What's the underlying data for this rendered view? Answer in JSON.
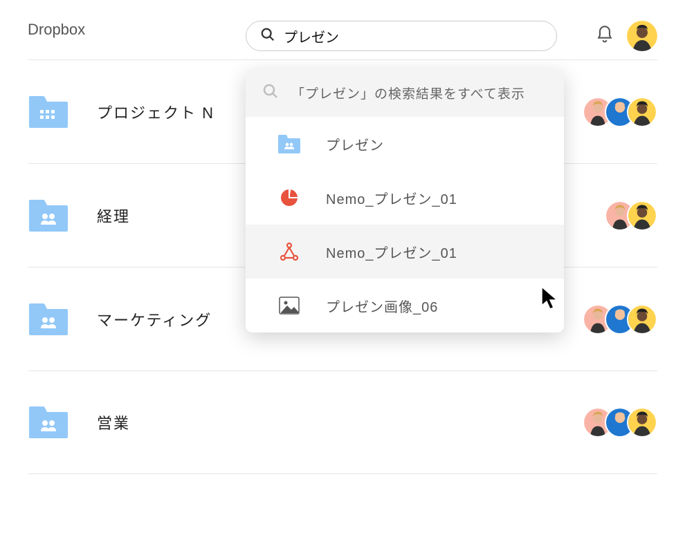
{
  "brand": "Dropbox",
  "search": {
    "value": "プレゼン"
  },
  "dropdown": {
    "header": "「プレゼン」の検索結果をすべて表示",
    "items": [
      {
        "icon": "folder-shared",
        "label": "プレゼン"
      },
      {
        "icon": "powerpoint",
        "label": "Nemo_プレゼン_01"
      },
      {
        "icon": "keynote",
        "label": "Nemo_プレゼン_01",
        "hover": true
      },
      {
        "icon": "image",
        "label": "プレゼン画像_06"
      }
    ]
  },
  "folders": [
    {
      "icon": "building",
      "name": "プロジェクト N",
      "avatars": [
        "pink-f1",
        "blue-m",
        "yellow-f2"
      ]
    },
    {
      "icon": "shared",
      "name": "経理",
      "avatars": [
        "pink-f1",
        "yellow-f2"
      ]
    },
    {
      "icon": "shared",
      "name": "マーケティング",
      "avatars": [
        "pink-f1",
        "blue-m",
        "yellow-f2"
      ]
    },
    {
      "icon": "shared",
      "name": "営業",
      "avatars": [
        "pink-f1",
        "blue-m",
        "yellow-f2"
      ]
    }
  ],
  "colors": {
    "folder": "#92c8f8",
    "folderDark": "#4ba3f2",
    "pink": "#f9b4a6",
    "blue": "#1f77d0",
    "yellow": "#ffd34e",
    "orange": "#e8533e"
  }
}
